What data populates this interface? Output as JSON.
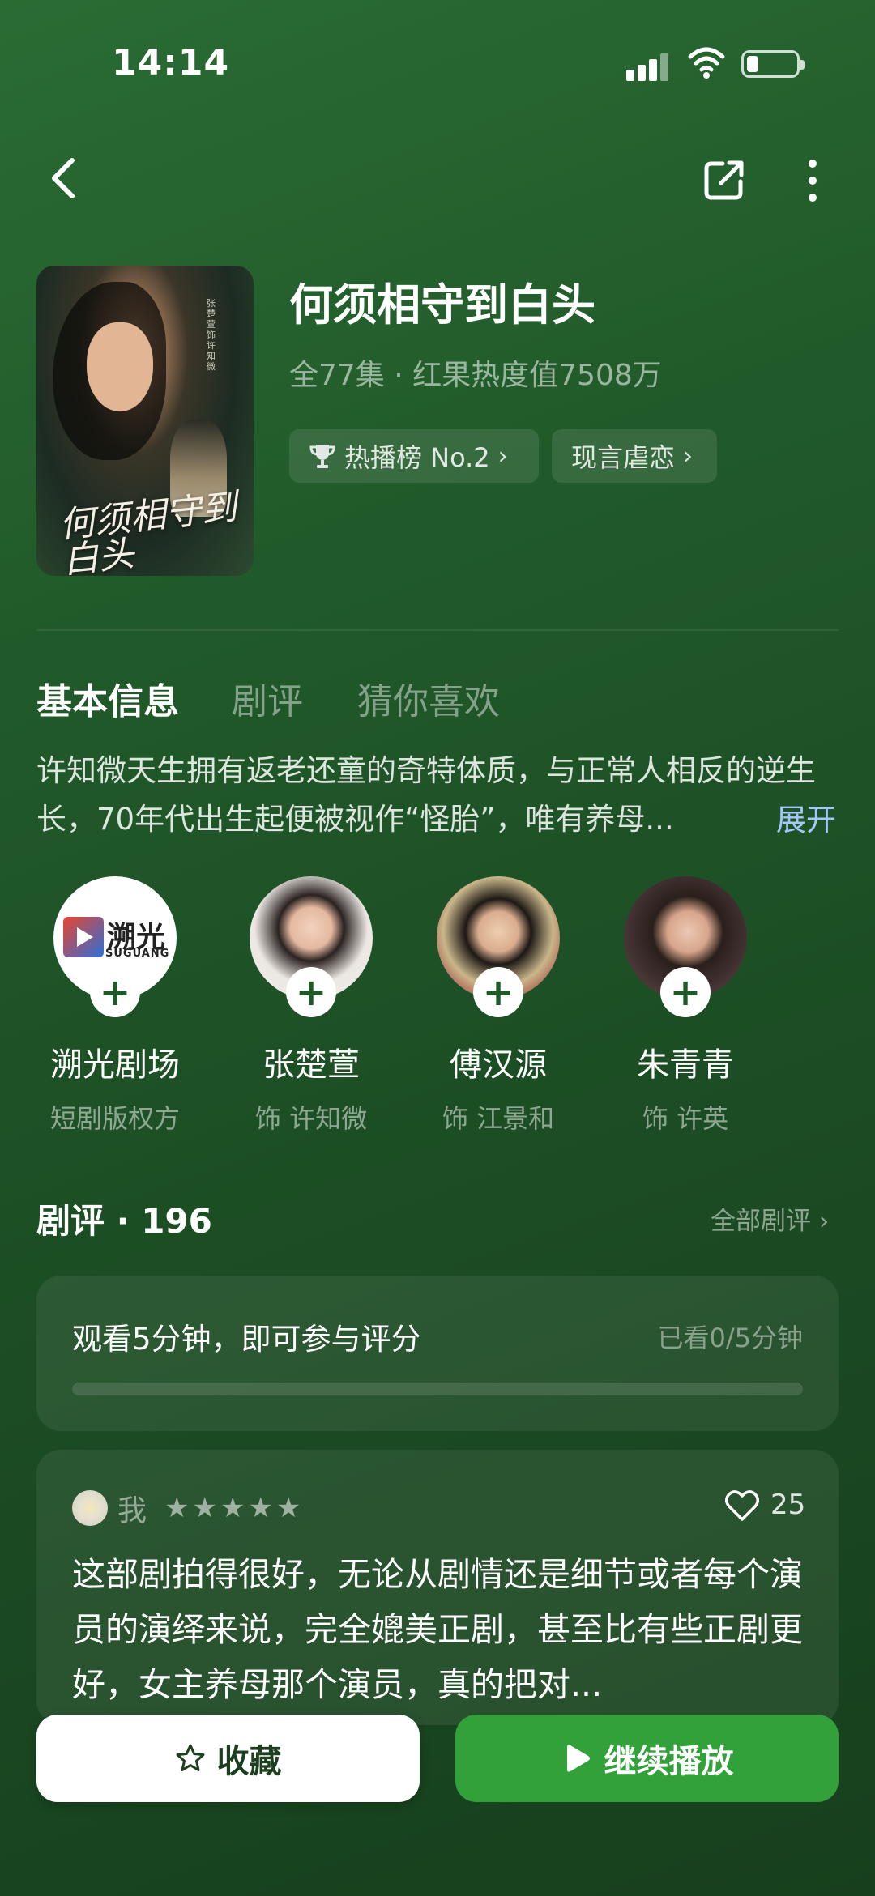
{
  "status_bar": {
    "time": "14:14"
  },
  "show": {
    "title": "何须相守到白头",
    "meta": "全77集 · 红果热度值7508万",
    "rank_chip": "热播榜 No.2",
    "genre_chip": "现言虐恋",
    "poster_title_art": "何须相守到白头",
    "poster_credit": "张楚萱饰许知微"
  },
  "tabs": [
    "基本信息",
    "剧评",
    "猜你喜欢"
  ],
  "synopsis": {
    "text": "许知微天生拥有返老还童的奇特体质，与正常人相反的逆生长，70年代出生起便被视作“怪胎”，唯有养母...",
    "expand_label": "展开"
  },
  "cast": [
    {
      "name": "溯光剧场",
      "role": "短剧版权方",
      "logo_cn": "溯光",
      "logo_en": "SUGUANG"
    },
    {
      "name": "张楚萱",
      "role": "饰 许知微"
    },
    {
      "name": "傅汉源",
      "role": "饰 江景和"
    },
    {
      "name": "朱青青",
      "role": "饰 许英"
    }
  ],
  "reviews": {
    "header": "剧评 · 196",
    "all_label": "全部剧评",
    "rating_gate": {
      "text": "观看5分钟，即可参与评分",
      "progress_text": "已看0/5分钟",
      "progress": 0
    },
    "my_review": {
      "user": "我",
      "stars": "★★★★★",
      "likes": "25",
      "body": "这部剧拍得很好，无论从剧情还是细节或者每个演员的演绎来说，完全媲美正剧，甚至比有些正剧更好，女主养母那个演员，真的把对..."
    }
  },
  "actions": {
    "favorite_label": "收藏",
    "play_label": "继续播放"
  },
  "colors": {
    "accent": "#32a13a",
    "background": "#1f5528",
    "link": "#a5c7ff"
  }
}
